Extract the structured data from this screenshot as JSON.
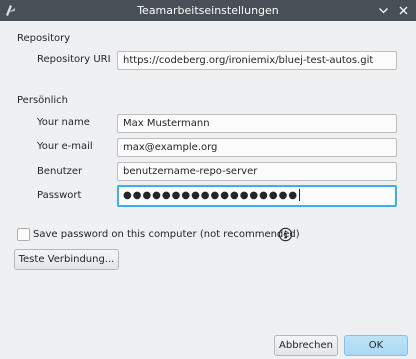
{
  "window": {
    "title": "Teamarbeitseinstellungen",
    "icons": {
      "app": "bluej-app-icon",
      "minimize": "chevron-down-icon",
      "close": "close-icon"
    },
    "accent_color": "#3daee9"
  },
  "repository": {
    "section_label": "Repository",
    "uri_label": "Repository URI",
    "uri_value": "https://codeberg.org/ironiemix/bluej-test-autos.git"
  },
  "personal": {
    "section_label": "Persönlich",
    "name_label": "Your name",
    "name_value": "Max Mustermann",
    "email_label": "Your e-mail",
    "email_value": "max@example.org",
    "user_label": "Benutzer",
    "user_value": "benutzername-repo-server",
    "password_label": "Passwort",
    "password_value": "●●●●●●●●●●●●●●●●●●"
  },
  "options": {
    "save_password_label": "Save password on this computer (not recommended)",
    "save_password_checked": false,
    "info_icon": "info-icon"
  },
  "buttons": {
    "test_label": "Teste Verbindung...",
    "cancel_label": "Abbrechen",
    "ok_label": "OK"
  }
}
